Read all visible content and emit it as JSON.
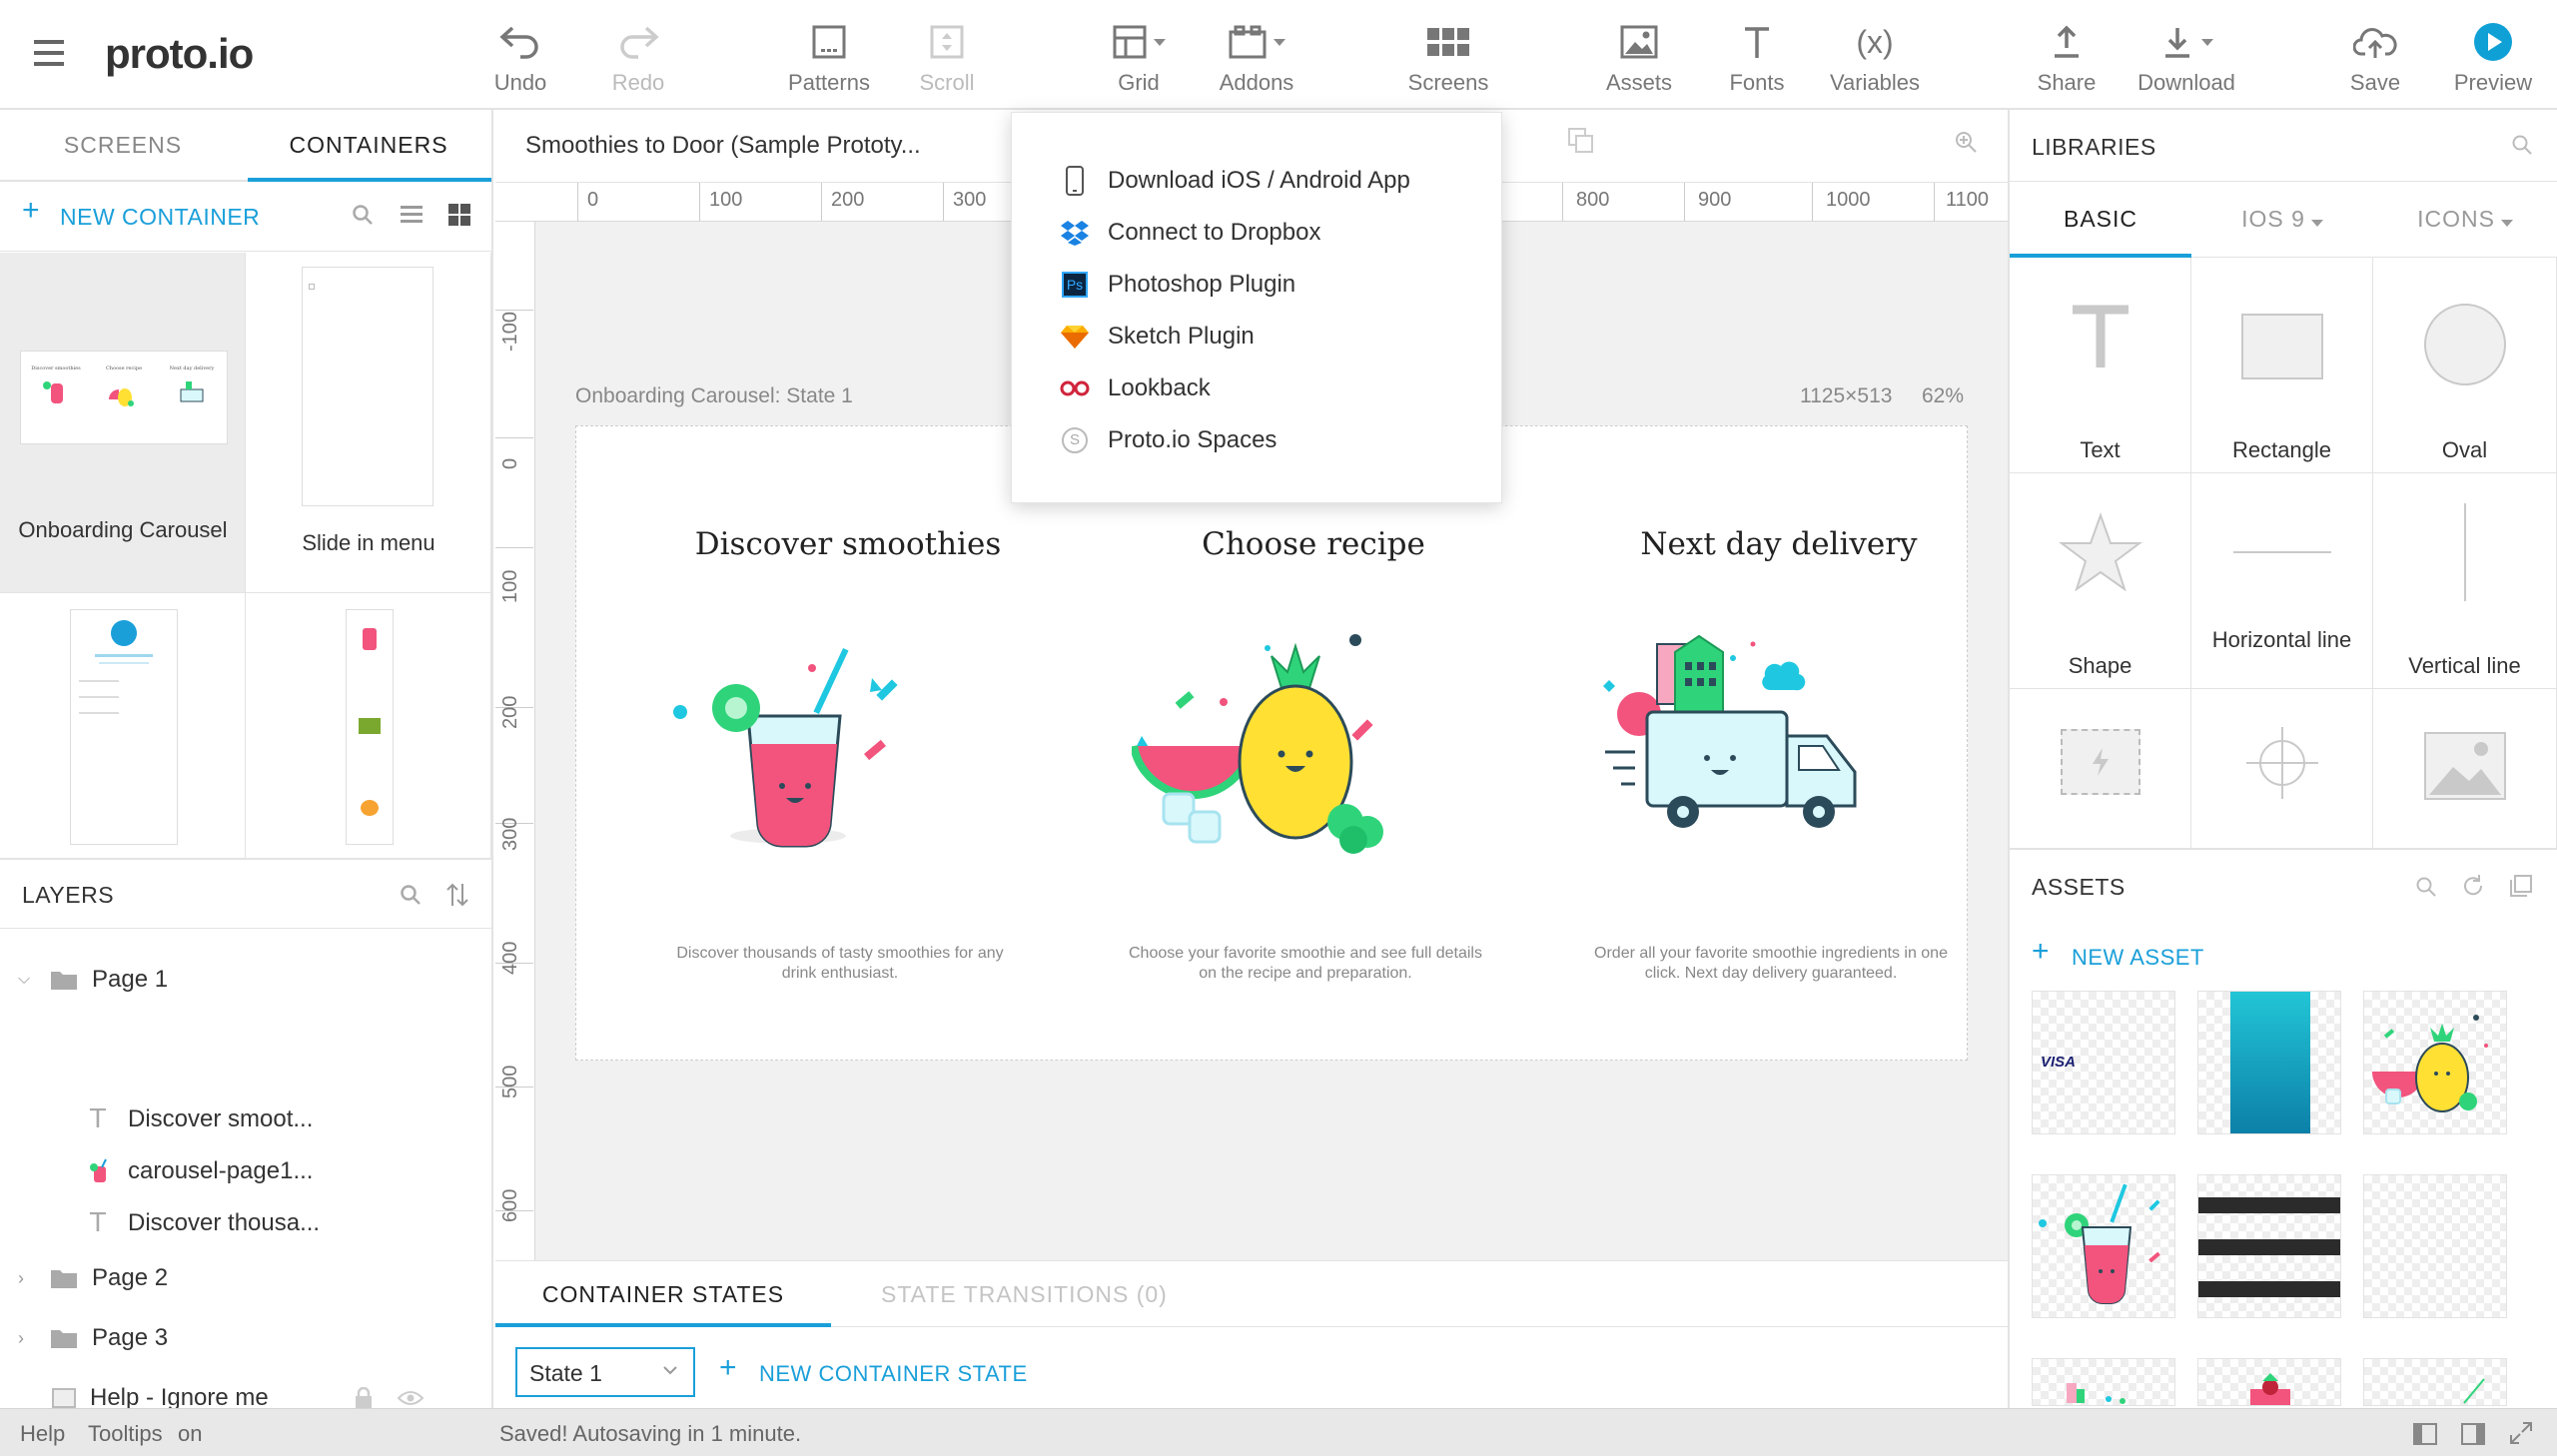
{
  "app": {
    "logo": "proto.io"
  },
  "toolbar": {
    "undo": "Undo",
    "redo": "Redo",
    "patterns": "Patterns",
    "scroll": "Scroll",
    "grid": "Grid",
    "addons": "Addons",
    "screens": "Screens",
    "assets": "Assets",
    "fonts": "Fonts",
    "variables": "Variables",
    "variables_icon": "(x)",
    "share": "Share",
    "download": "Download",
    "save": "Save",
    "preview": "Preview"
  },
  "left": {
    "tabs": [
      "SCREENS",
      "CONTAINERS"
    ],
    "active_tab": "CONTAINERS",
    "new_container": "NEW CONTAINER",
    "containers": [
      {
        "label": "Onboarding Carousel"
      },
      {
        "label": "Slide in menu"
      },
      {
        "label": ""
      },
      {
        "label": ""
      }
    ],
    "layers_title": "LAYERS",
    "layers": [
      {
        "label": "Page 1",
        "type": "folder",
        "expanded": true
      },
      {
        "label": "Discover smoot...",
        "type": "text"
      },
      {
        "label": "carousel-page1...",
        "type": "image"
      },
      {
        "label": "Discover thousa...",
        "type": "text"
      },
      {
        "label": "Page 2",
        "type": "folder"
      },
      {
        "label": "Page 3",
        "type": "folder"
      },
      {
        "label": "Help - Ignore me",
        "type": "box"
      }
    ]
  },
  "center": {
    "document_title": "Smoothies to Door (Sample Prototy...",
    "ruler_top": [
      "0",
      "100",
      "200",
      "300",
      "800",
      "900",
      "1000",
      "1100"
    ],
    "ruler_left": [
      "-100",
      "0",
      "100",
      "200",
      "300",
      "400",
      "500",
      "600"
    ],
    "canvas_label": "Onboarding Carousel: State 1",
    "canvas_size": "1125×513",
    "zoom": "62%",
    "slides": [
      {
        "title": "Discover smoothies",
        "desc": "Discover thousands of tasty smoothies for any drink enthusiast."
      },
      {
        "title": "Choose recipe",
        "desc": "Choose your favorite smoothie and see full details on the recipe and preparation."
      },
      {
        "title": "Next day delivery",
        "desc": "Order all your favorite smoothie ingredients in one click. Next day delivery guaranteed."
      }
    ],
    "bottom_tabs": [
      "CONTAINER STATES",
      "STATE TRANSITIONS (0)"
    ],
    "state_select": "State 1",
    "new_state": "NEW CONTAINER STATE"
  },
  "addons_menu": {
    "items": [
      {
        "label": "Download iOS / Android App",
        "icon": "phone-icon"
      },
      {
        "label": "Connect to Dropbox",
        "icon": "dropbox-icon"
      },
      {
        "label": "Photoshop Plugin",
        "icon": "photoshop-icon",
        "icon_text": "Ps"
      },
      {
        "label": "Sketch Plugin",
        "icon": "sketch-icon"
      },
      {
        "label": "Lookback",
        "icon": "lookback-icon"
      },
      {
        "label": "Proto.io Spaces",
        "icon": "spaces-icon",
        "icon_text": "S"
      }
    ]
  },
  "right": {
    "libraries_title": "LIBRARIES",
    "lib_tabs": [
      "BASIC",
      "IOS 9",
      "ICONS"
    ],
    "items": [
      "Text",
      "Rectangle",
      "Oval",
      "Shape",
      "Horizontal line",
      "Vertical line",
      "",
      "",
      ""
    ],
    "assets_title": "ASSETS",
    "new_asset": "NEW ASSET",
    "visa_text": "VISA"
  },
  "status": {
    "help": "Help",
    "tooltips": "Tooltips",
    "tooltips_state": "on",
    "message": "Saved! Autosaving in 1 minute."
  },
  "colors": {
    "accent": "#1a9fd9",
    "preview": "#0fa0d6",
    "pink": "#f2547d",
    "green": "#2fd47a"
  }
}
